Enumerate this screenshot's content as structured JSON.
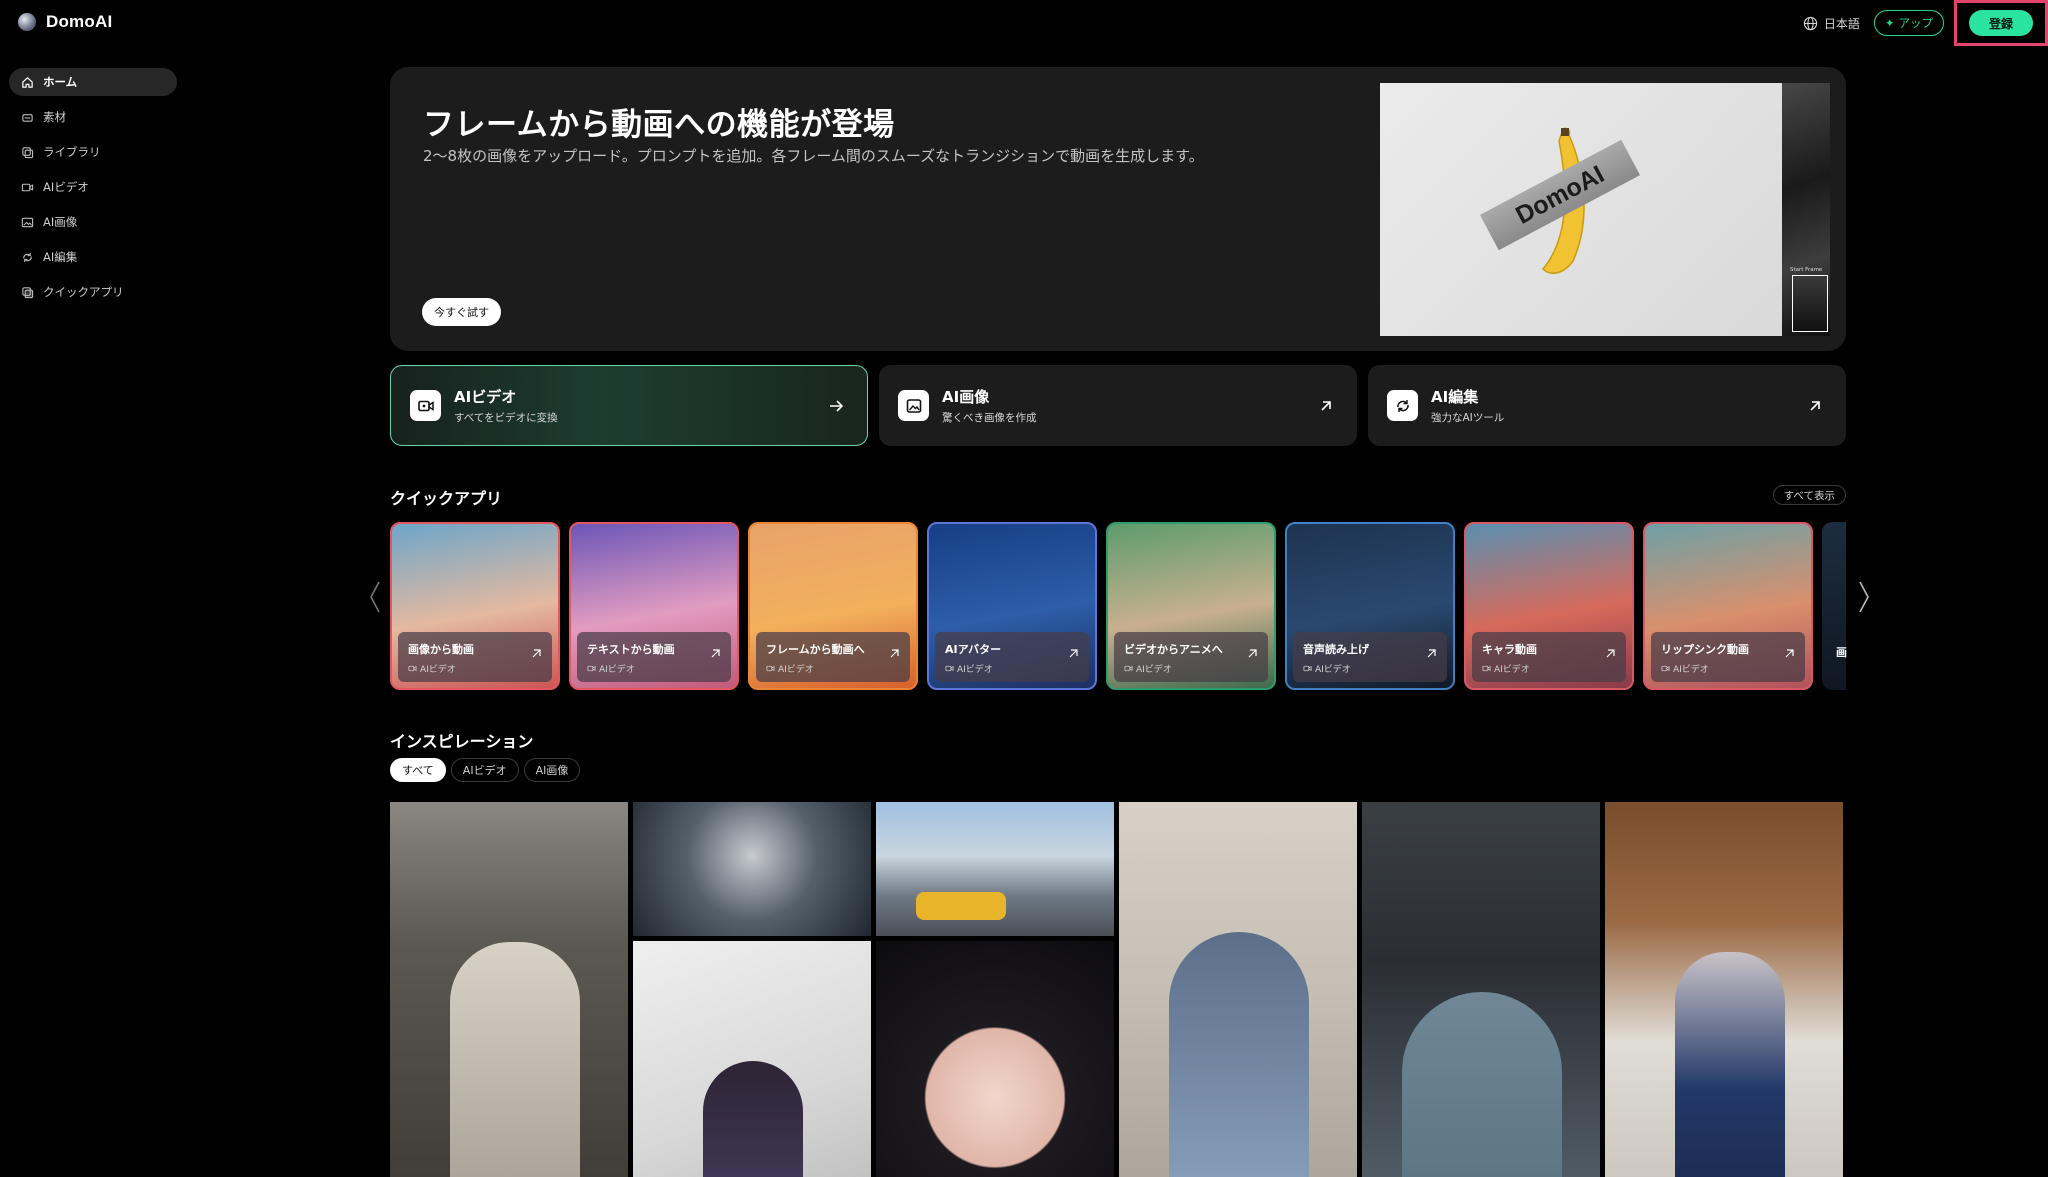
{
  "brand": {
    "name": "DomoAI"
  },
  "topbar": {
    "language": "日本語",
    "app_label": "アップ",
    "register_label": "登録"
  },
  "sidebar": {
    "items": [
      {
        "label": "ホーム",
        "icon": "home-icon",
        "active": true
      },
      {
        "label": "素材",
        "icon": "assets-icon"
      },
      {
        "label": "ライブラリ",
        "icon": "library-icon"
      },
      {
        "label": "AIビデオ",
        "icon": "video-icon"
      },
      {
        "label": "AI画像",
        "icon": "image-icon"
      },
      {
        "label": "AI編集",
        "icon": "edit-icon"
      },
      {
        "label": "クイックアプリ",
        "icon": "apps-icon"
      }
    ]
  },
  "hero": {
    "title": "フレームから動画への機能が登場",
    "subtitle": "2～8枚の画像をアップロード。プロンプトを追加。各フレーム間のスムーズなトランジションで動画を生成します。",
    "cta": "今すぐ試す",
    "tape_text": "DomoAI",
    "side_label": "Start Frame"
  },
  "features": [
    {
      "title": "AIビデオ",
      "subtitle": "すべてをビデオに変換",
      "icon": "video-icon"
    },
    {
      "title": "AI画像",
      "subtitle": "驚くべき画像を作成",
      "icon": "image-icon"
    },
    {
      "title": "AI編集",
      "subtitle": "強力なAIツール",
      "icon": "edit-icon"
    }
  ],
  "quick_apps": {
    "title": "クイックアプリ",
    "show_all": "すべて表示",
    "items": [
      {
        "name": "画像から動画",
        "tag": "AIビデオ",
        "border": "#e3575f",
        "bg": [
          "#6da6c9",
          "#e4b9a0",
          "#c55"
        ]
      },
      {
        "name": "テキストから動画",
        "tag": "AIビデオ",
        "border": "#e3575f",
        "bg": [
          "#6b56b8",
          "#e29cc0",
          "#c35a7a"
        ]
      },
      {
        "name": "フレームから動画へ",
        "tag": "AIビデオ",
        "border": "#e98534",
        "bg": [
          "#e9a36a",
          "#f2b05d",
          "#d8602b"
        ]
      },
      {
        "name": "AIアバター",
        "tag": "AIビデオ",
        "border": "#5c76d8",
        "bg": [
          "#173e86",
          "#2d5ea8",
          "#1c2f62"
        ]
      },
      {
        "name": "ビデオからアニメへ",
        "tag": "AIビデオ",
        "border": "#2e9c70",
        "bg": [
          "#5d9c6d",
          "#c8b08f",
          "#3b6b4c"
        ]
      },
      {
        "name": "音声読み上げ",
        "tag": "AIビデオ",
        "border": "#3f80c2",
        "bg": [
          "#1e3350",
          "#2a4970",
          "#111a27"
        ]
      },
      {
        "name": "キャラ動画",
        "tag": "AIビデオ",
        "border": "#d85864",
        "bg": [
          "#5a8fb0",
          "#d76a5b",
          "#8a3a4b"
        ]
      },
      {
        "name": "リップシンク動画",
        "tag": "AIビデオ",
        "border": "#d85864",
        "bg": [
          "#6da0a6",
          "#d9906d",
          "#b4515b"
        ]
      }
    ],
    "partial_label": "画"
  },
  "inspiration": {
    "title": "インスピレーション",
    "filters": [
      {
        "label": "すべて",
        "active": true
      },
      {
        "label": "AIビデオ"
      },
      {
        "label": "AI画像"
      }
    ]
  }
}
